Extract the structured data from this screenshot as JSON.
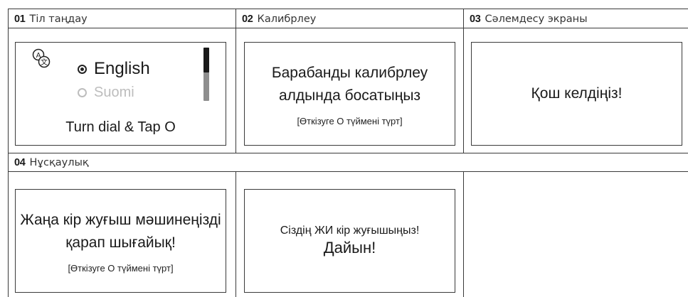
{
  "sections": [
    {
      "number": "01",
      "title": "Тіл таңдау",
      "screen": {
        "languages": [
          {
            "label": "English",
            "selected": true
          },
          {
            "label": "Suomi",
            "selected": false
          }
        ],
        "instruction": "Turn dial & Tap O"
      }
    },
    {
      "number": "02",
      "title": "Калибрлеу",
      "screen": {
        "line1": "Барабанды калибрлеу",
        "line2": "алдында босатыңыз",
        "hint": "[Өткізуге О түймені түрт]"
      }
    },
    {
      "number": "03",
      "title": "Сәлемдесу экраны",
      "screen": {
        "message": "Қош келдіңіз!"
      }
    },
    {
      "number": "04",
      "title": "Нұсқаулық",
      "screens": [
        {
          "line1": "Жаңа кір жуғыш мәшинеңізді",
          "line2": "қарап шығайық!",
          "hint": "[Өткізуге О түймені түрт]"
        },
        {
          "line1": "Сіздің ЖИ кір жуғышыңыз!",
          "line2": "Дайын!"
        }
      ]
    }
  ],
  "colors": {
    "line": "#3a3a3a",
    "text": "#1a1a1a",
    "muted": "#bdbdbd",
    "scrollbar": "#8e8e8e"
  }
}
